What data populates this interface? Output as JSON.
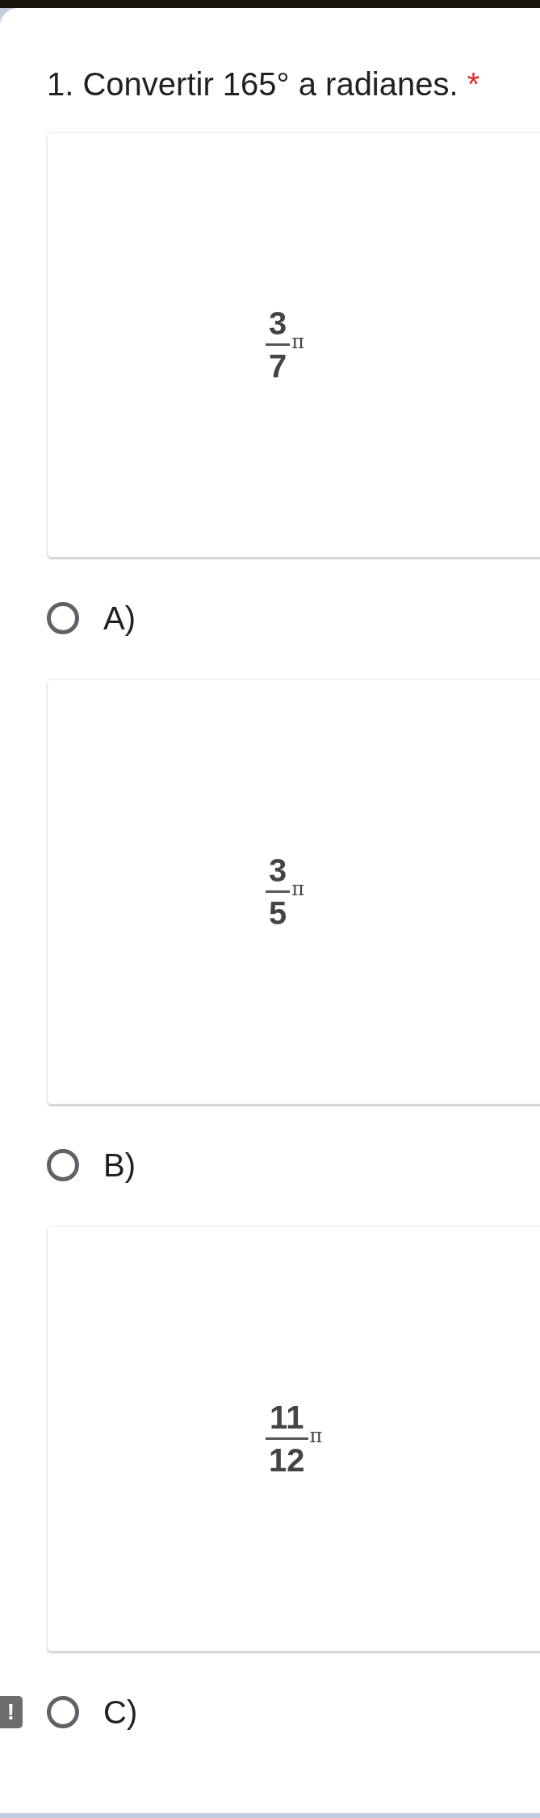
{
  "question": {
    "number": "1.",
    "text": "Convertir 165° a radianes.",
    "required_mark": "*"
  },
  "options": [
    {
      "label": "A)",
      "selected": false,
      "image": {
        "numerator": "3",
        "denominator": "7",
        "symbol": "π"
      }
    },
    {
      "label": "B)",
      "selected": false,
      "image": {
        "numerator": "3",
        "denominator": "5",
        "symbol": "π"
      }
    },
    {
      "label": "C)",
      "selected": false,
      "badge": "!",
      "image": {
        "numerator": "11",
        "denominator": "12",
        "symbol": "π"
      }
    }
  ]
}
